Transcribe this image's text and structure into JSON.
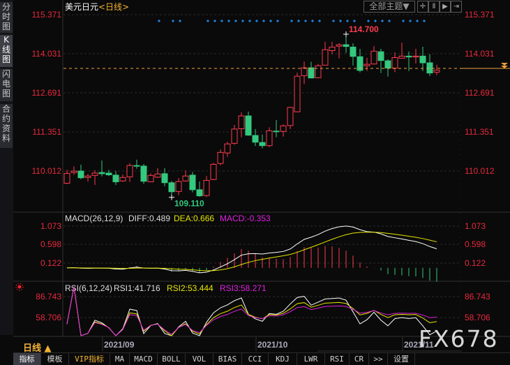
{
  "sidebar": {
    "tabs": [
      {
        "label": "分时图"
      },
      {
        "label": "K线图",
        "selected": true
      },
      {
        "label": "闪电图"
      },
      {
        "label": "合约资料"
      }
    ]
  },
  "header": {
    "symbol": "美元日元",
    "period_tag": "<日线>",
    "theme_button": "全部主题▼"
  },
  "colors": {
    "up": "#ff3b4f",
    "down": "#33c97f",
    "diff": "#ffffff",
    "dea": "#e6e600",
    "macd": "#e020e0",
    "last_price": "#f0a040",
    "signal_dot": "#1e88e5"
  },
  "period_selector": "日线 ▲",
  "watermark": "FX678",
  "toolbar": [
    "指标",
    "模板",
    "VIP指标",
    "MA",
    "MACD",
    "BOLL",
    "VOL",
    "BIAS",
    "CCI",
    "KDJ",
    "LWR",
    "RSI",
    "CR",
    ">>",
    "设置"
  ],
  "chart_data": {
    "type": "candlestick",
    "title": "美元日元<日线>",
    "y_ticks": [
      "115.371",
      "114.031",
      "112.691",
      "111.351",
      "110.012"
    ],
    "ylim": [
      109.0,
      115.371
    ],
    "x_labels": [
      {
        "label": "2021/09",
        "index": 5
      },
      {
        "label": "2021/10",
        "index": 27
      },
      {
        "label": "2021/11",
        "index": 48
      }
    ],
    "high_label": {
      "text": "114.700",
      "index": 40,
      "value": 114.7
    },
    "low_label": {
      "text": "109.110",
      "index": 15,
      "value": 109.11
    },
    "last_price": 113.53,
    "signal_dot_indices": [
      13,
      15,
      16,
      20,
      21,
      22,
      23,
      24,
      25,
      26,
      27,
      28,
      29,
      30,
      32,
      33,
      34,
      35,
      36,
      38,
      39,
      40,
      41,
      43,
      44,
      45,
      46,
      48,
      49,
      50,
      51
    ],
    "candles_ohlc": [
      [
        109.59,
        110.05,
        109.56,
        109.93
      ],
      [
        109.96,
        110.17,
        109.88,
        110.01
      ],
      [
        110.01,
        110.23,
        109.73,
        109.78
      ],
      [
        109.79,
        109.91,
        109.65,
        109.84
      ],
      [
        109.86,
        110.04,
        109.53,
        109.94
      ],
      [
        109.96,
        110.37,
        109.83,
        109.92
      ],
      [
        109.94,
        110.05,
        109.84,
        109.88
      ],
      [
        109.87,
        110.01,
        109.53,
        109.64
      ],
      [
        109.67,
        109.89,
        109.64,
        109.79
      ],
      [
        109.81,
        110.28,
        109.64,
        110.2
      ],
      [
        110.2,
        110.4,
        110.09,
        110.18
      ],
      [
        110.18,
        110.25,
        109.57,
        109.66
      ],
      [
        109.64,
        109.93,
        109.63,
        109.86
      ],
      [
        109.8,
        110.11,
        109.77,
        109.91
      ],
      [
        109.92,
        110.11,
        109.49,
        109.61
      ],
      [
        109.61,
        109.67,
        109.11,
        109.3
      ],
      [
        109.31,
        109.77,
        109.18,
        109.65
      ],
      [
        109.67,
        110.03,
        109.64,
        109.84
      ],
      [
        109.87,
        109.98,
        109.28,
        109.37
      ],
      [
        109.37,
        109.65,
        109.13,
        109.16
      ],
      [
        109.17,
        109.84,
        109.12,
        109.69
      ],
      [
        109.72,
        110.29,
        109.7,
        110.24
      ],
      [
        110.27,
        110.75,
        110.21,
        110.65
      ],
      [
        110.63,
        111.01,
        110.5,
        110.94
      ],
      [
        110.96,
        111.59,
        110.91,
        111.45
      ],
      [
        111.46,
        112.02,
        111.17,
        111.9
      ],
      [
        111.9,
        112.05,
        111.22,
        111.24
      ],
      [
        111.23,
        111.45,
        110.87,
        111.0
      ],
      [
        110.99,
        111.26,
        110.79,
        110.88
      ],
      [
        110.88,
        111.51,
        110.83,
        111.39
      ],
      [
        111.38,
        111.76,
        111.17,
        111.36
      ],
      [
        111.37,
        111.61,
        111.19,
        111.56
      ],
      [
        111.57,
        112.21,
        111.45,
        112.19
      ],
      [
        112.04,
        113.38,
        112.04,
        113.26
      ],
      [
        113.28,
        113.76,
        112.99,
        113.55
      ],
      [
        113.55,
        113.76,
        113.2,
        113.2
      ],
      [
        113.21,
        113.68,
        113.21,
        113.62
      ],
      [
        113.64,
        114.44,
        113.64,
        114.17
      ],
      [
        114.14,
        114.44,
        114.01,
        114.26
      ],
      [
        114.29,
        114.39,
        113.87,
        114.34
      ],
      [
        114.34,
        114.7,
        114.06,
        114.28
      ],
      [
        114.26,
        114.39,
        113.63,
        113.94
      ],
      [
        113.93,
        114.2,
        113.39,
        113.46
      ],
      [
        113.62,
        113.89,
        113.44,
        113.67
      ],
      [
        113.68,
        114.29,
        113.66,
        114.12
      ],
      [
        114.1,
        114.2,
        113.37,
        113.8
      ],
      [
        113.79,
        113.84,
        113.25,
        113.54
      ],
      [
        113.54,
        114.08,
        113.4,
        113.9
      ],
      [
        113.88,
        114.41,
        113.88,
        113.95
      ],
      [
        113.95,
        114.11,
        113.44,
        113.92
      ],
      [
        113.92,
        114.2,
        113.7,
        113.95
      ],
      [
        113.95,
        114.27,
        113.44,
        113.72
      ],
      [
        113.72,
        114.01,
        113.27,
        113.37
      ],
      [
        113.4,
        113.65,
        113.3,
        113.47
      ]
    ],
    "macd": {
      "label": "MACD(26,12,9)",
      "diff_text": "DIFF:0.489",
      "dea_text": "DEA:0.666",
      "macd_text": "MACD:-0.353",
      "y_ticks": [
        "1.073",
        "0.598",
        "0.122"
      ],
      "last": {
        "diff": 0.489,
        "dea": 0.666,
        "macd": -0.353
      }
    },
    "rsi": {
      "label": "RSI(6,12,24)",
      "rsi1_text": "RSI1:41.716",
      "rsi2_text": "RSI2:53.444",
      "rsi3_text": "RSI3:58.271",
      "y_ticks": [
        "86.743",
        "58.706"
      ],
      "last": {
        "rsi1": 41.716,
        "rsi2": 53.444,
        "rsi3": 58.271
      }
    }
  }
}
